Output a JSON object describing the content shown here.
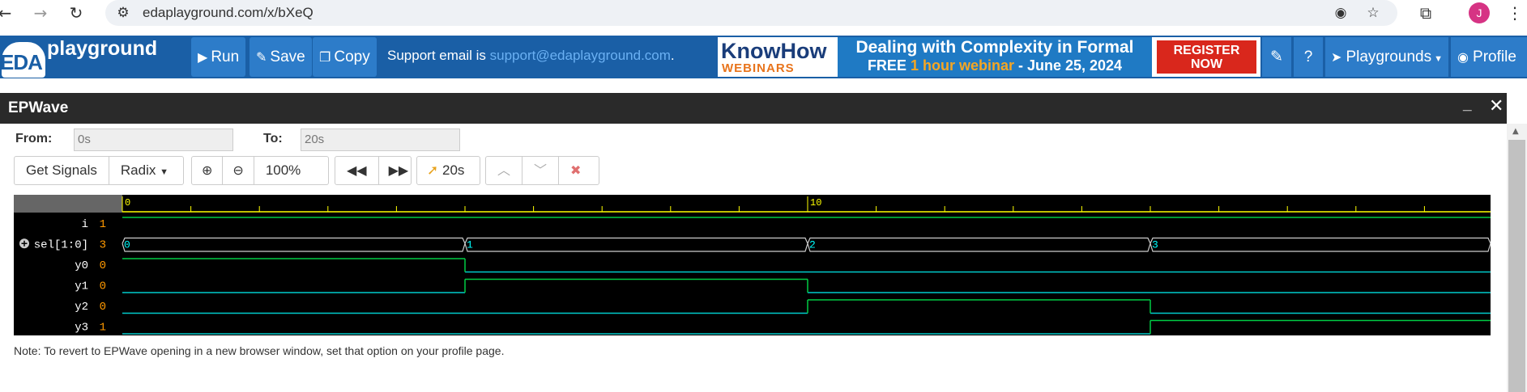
{
  "browser": {
    "url": "edaplayground.com/x/bXeQ",
    "avatar_letter": "J"
  },
  "header": {
    "logo_eda": "EDA",
    "logo_playground": "playground",
    "run_label": "Run",
    "save_label": "Save",
    "copy_label": "Copy",
    "support_prefix": "Support email is ",
    "support_email": "support@edaplayground.com",
    "support_suffix": ".",
    "playgrounds_label": "Playgrounds",
    "profile_label": "Profile"
  },
  "ad": {
    "brand": "KnowHow",
    "brand_sub": "WEBINARS",
    "line1": "Dealing with Complexity in Formal",
    "line2_prefix": "FREE ",
    "line2_highlight": "1 hour webinar",
    "line2_suffix": " - June 25, 2024",
    "cta_line1": "REGISTER",
    "cta_line2": "NOW"
  },
  "epwave": {
    "title": "EPWave",
    "from_label": "From:",
    "from_value": "0s",
    "to_label": "To:",
    "to_value": "20s",
    "get_signals": "Get Signals",
    "radix": "Radix",
    "zoom": "100%",
    "cursor_time": "20s",
    "note": "Note: To revert to EPWave opening in a new browser window, set that option on your profile page."
  },
  "waveform": {
    "time_labels": [
      "0",
      "10"
    ],
    "time_range_ns": [
      0,
      20
    ],
    "signals": [
      {
        "name": "i",
        "value": "1",
        "type": "bit",
        "segments": [
          [
            0,
            20,
            1
          ]
        ]
      },
      {
        "name": "sel[1:0]",
        "value": "3",
        "type": "bus",
        "expandable": true,
        "segments": [
          [
            0,
            5,
            "0"
          ],
          [
            5,
            10,
            "1"
          ],
          [
            10,
            15,
            "2"
          ],
          [
            15,
            20,
            "3"
          ]
        ]
      },
      {
        "name": "y0",
        "value": "0",
        "type": "bit",
        "segments": [
          [
            0,
            5,
            1
          ],
          [
            5,
            20,
            0
          ]
        ]
      },
      {
        "name": "y1",
        "value": "0",
        "type": "bit",
        "segments": [
          [
            0,
            5,
            0
          ],
          [
            5,
            10,
            1
          ],
          [
            10,
            20,
            0
          ]
        ]
      },
      {
        "name": "y2",
        "value": "0",
        "type": "bit",
        "segments": [
          [
            0,
            10,
            0
          ],
          [
            10,
            15,
            1
          ],
          [
            15,
            20,
            0
          ]
        ]
      },
      {
        "name": "y3",
        "value": "1",
        "type": "bit",
        "segments": [
          [
            0,
            15,
            0
          ],
          [
            15,
            20,
            1
          ]
        ]
      }
    ],
    "colors": {
      "ruler": "#666666",
      "ruler_text": "#ffff00",
      "signal_name": "#ffffff",
      "signal_value": "#ff9900",
      "wave_high": "#00cc44",
      "wave_low": "#00cccc",
      "bus": "#cccccc",
      "bus_text": "#00ffff"
    }
  }
}
